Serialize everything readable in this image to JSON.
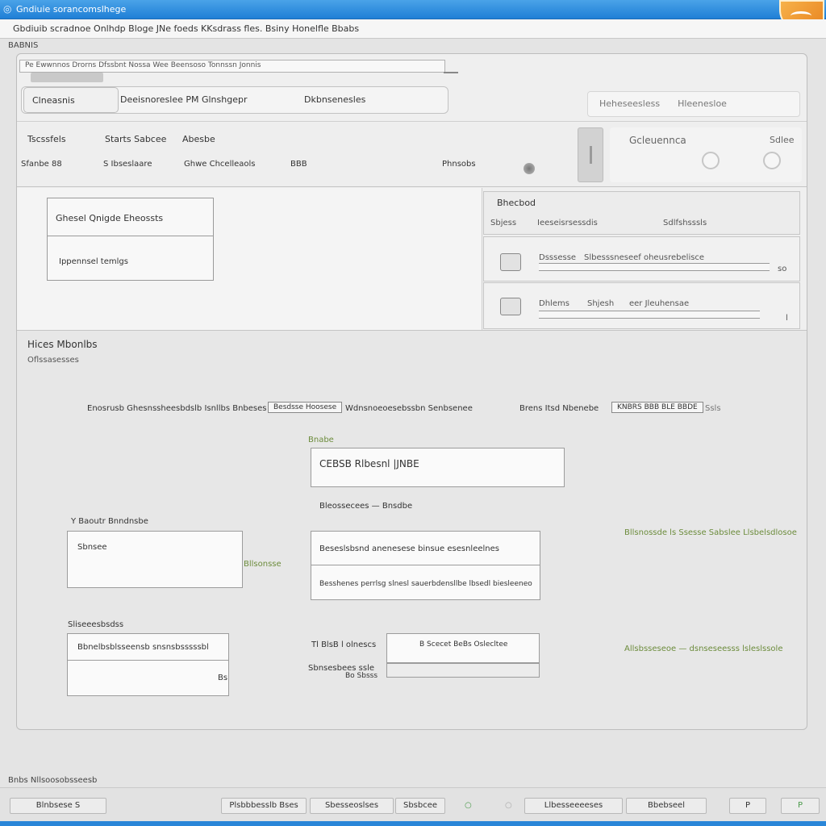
{
  "window": {
    "title": "Gndiuie sorancomslhege",
    "toolbar_text": "Gbdiuib scradnoe Onlhdp Bloge JNe foeds KKsdrass fles. Bsiny Honelfle Bbabs"
  },
  "section_label": "BABNIS",
  "header": {
    "address": "Pe Ewwnnos Drorns Dfssbnt Nossa Wee Beensoso Tonnssn Jonnis",
    "tabs": [
      {
        "label": "Clneasnis"
      },
      {
        "label": "Deeisnoreslee PM Glnshgepr"
      },
      {
        "label": "Dkbnsenesles"
      }
    ],
    "right_field": [
      "Heheseesless",
      "Hleenesloe"
    ]
  },
  "info": {
    "labels": [
      "Tscssfels",
      "Starts Sabcee",
      "Abesbe"
    ],
    "values": [
      "Sfanbe 88",
      "S Ibseslaare",
      "Ghwe Chcelleaols",
      "BBB",
      "Phnsobs"
    ],
    "panel_title": "Gcleuennca",
    "panel_right": "Sdlee"
  },
  "left_card": {
    "title": "Ghesel Qnigde Eheossts",
    "subtitle": "Ippennsel temlgs"
  },
  "right_list": {
    "title": "Bhecbod",
    "columns": [
      "Sbjess",
      "Ieeseisrsessdis",
      "Sdlfshsssls"
    ],
    "items": [
      {
        "name": "Dsssesse",
        "detail": "Slbesssneseef oheusrebelisce",
        "value": "so"
      },
      {
        "name": "Dhlems",
        "detail": "Shjesh",
        "extra": "eer Jleuhensae",
        "value": "l"
      }
    ]
  },
  "lower": {
    "title": "Hices Mbonlbs",
    "subtitle": "Oflssasesses",
    "row1_label": "Enosrusb Ghesnssheesbdslb Isnllbs Bnbeses Ines",
    "row1_box": "Besdsse Hoosese",
    "row1_hint": "Wdnsnoeoesebssbn Senbsenee",
    "row1_right_label": "Brens Itsd Nbenebe",
    "row1_right_box": "KNBRS BBB BLE BBDE",
    "row1_right_hint": "Ssls",
    "center_caption": "Bnabe",
    "center_field": "CEBSB Rlbesnl |JNBE",
    "center_sub": "Bleossecees — Bnsdbe",
    "left_group1": "Y Baoutr Bnndnsbe",
    "left_field1": "Sbnsee",
    "left_hint1": "Bllsonsse",
    "center_box_lines": [
      "Beseslsbsnd anenesese binsue esesnleelnes",
      "Besshenes perrlsg slnesl sauerbdensllbe lbsedl biesleeneo"
    ],
    "right_hint1": "Bllsnossde ls Ssesse Sabslee Llsbelsdlosoe",
    "left_group2": "Sliseeesbsdss",
    "left_field2_top": "Bbnelbsblsseensb snsnsbsssssbl",
    "left_field2_mark": "Bs",
    "mid_label1": "Tl BlsB l olnescs",
    "mid_label2": "Sbnsesbees ssle",
    "mid_label2b": "Bo Sbsss",
    "mid_box": "B Scecet BeBs Oslecltee",
    "right_hint2": "Allsbsseseoe — dsnseseesss lsleslssole"
  },
  "status_label": "Bnbs Nllsoosobsseesb",
  "footer": {
    "buttons": [
      "Blnbsese S",
      "Plsbbbesslb Bses",
      "Sbesseoslses",
      "Sbsbcee",
      "Llbesseeeeses",
      "Bbebseel",
      "P",
      "P"
    ]
  },
  "colors": {
    "titlebar": "#1f7fd6",
    "accent_orange": "#e8831f",
    "hint_green": "#6c8c3c"
  },
  "icons": [
    "app-logo-icon",
    "orange-badge-icon",
    "radio-dot-icon",
    "window-control-icon",
    "gear-icon",
    "ship-icon",
    "monitor-icon",
    "green-dot-icon"
  ]
}
